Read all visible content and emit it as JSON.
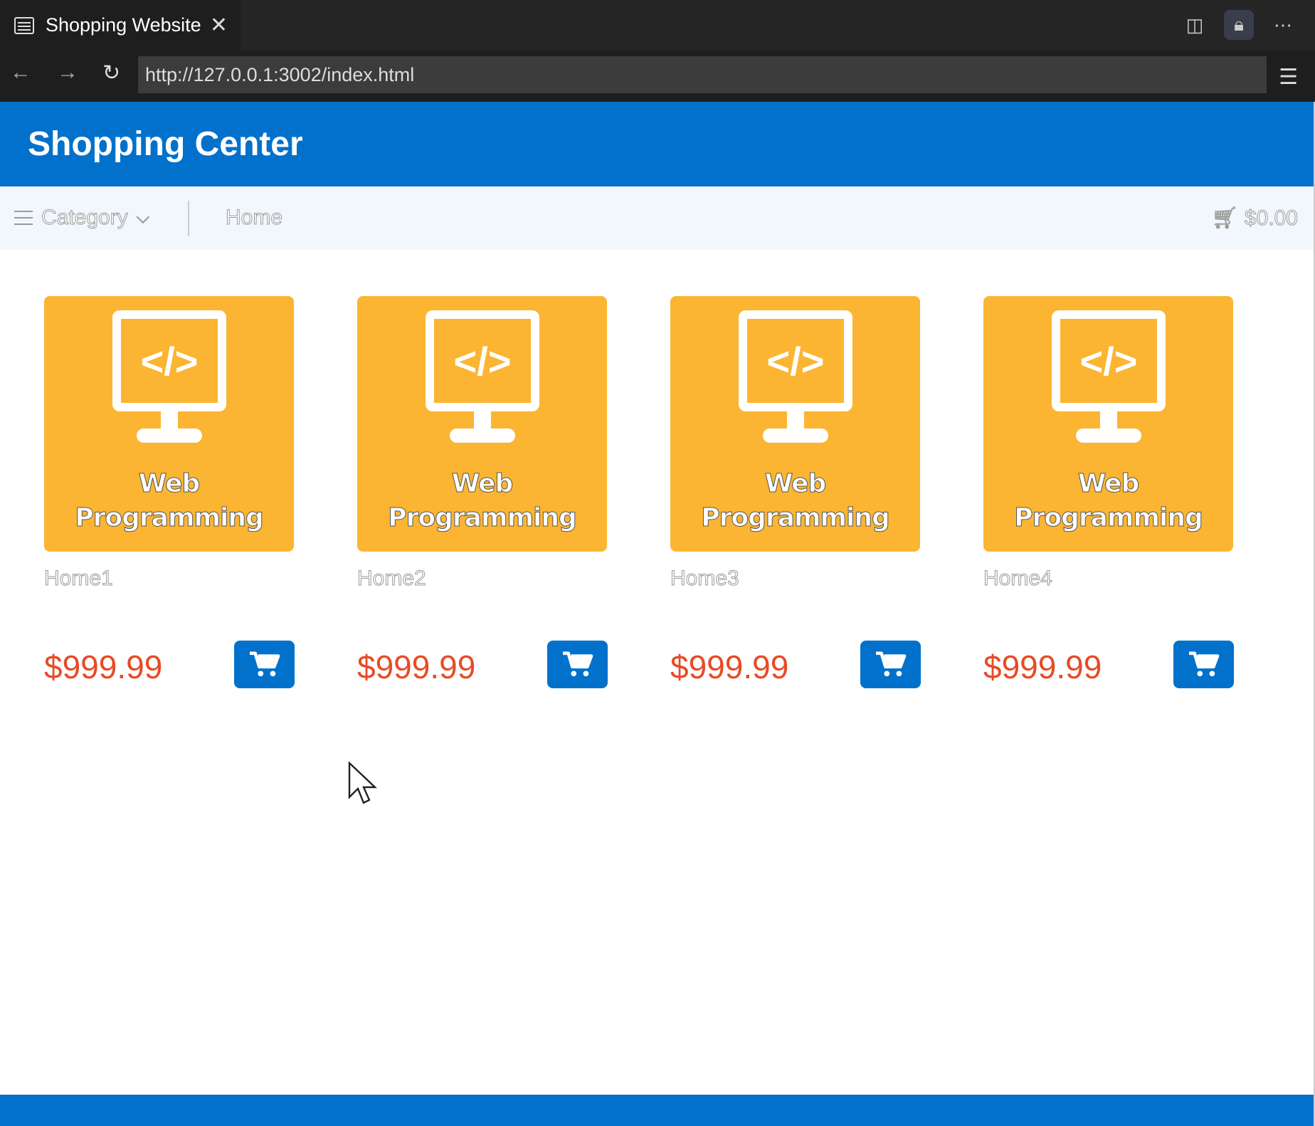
{
  "browser": {
    "tab_title": "Shopping Website",
    "url": "http://127.0.0.1:3002/index.html"
  },
  "header": {
    "title": "Shopping Center"
  },
  "nav": {
    "category": "Category",
    "home": "Home",
    "cart_total": "$0.00"
  },
  "products": [
    {
      "image_text_1": "Web",
      "image_text_2": "Programming",
      "name": "Home1",
      "price": "$999.99"
    },
    {
      "image_text_1": "Web",
      "image_text_2": "Programming",
      "name": "Home2",
      "price": "$999.99"
    },
    {
      "image_text_1": "Web",
      "image_text_2": "Programming",
      "name": "Home3",
      "price": "$999.99"
    },
    {
      "image_text_1": "Web",
      "image_text_2": "Programming",
      "name": "Home4",
      "price": "$999.99"
    }
  ],
  "colors": {
    "brand": "#0271cb",
    "product_bg": "#fbb532",
    "price": "#e74b26"
  }
}
